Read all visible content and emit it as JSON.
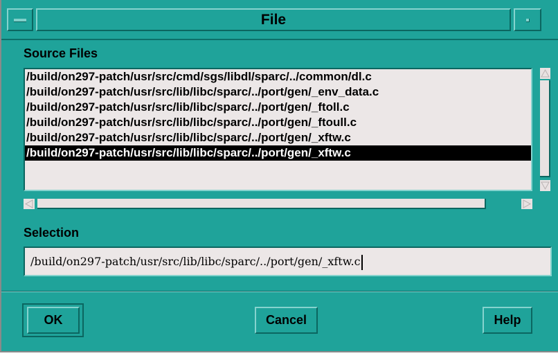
{
  "window": {
    "title": "File"
  },
  "source_files": {
    "label": "Source Files",
    "items": [
      "/build/on297-patch/usr/src/cmd/sgs/libdl/sparc/../common/dl.c",
      "/build/on297-patch/usr/src/lib/libc/sparc/../port/gen/_env_data.c",
      "/build/on297-patch/usr/src/lib/libc/sparc/../port/gen/_ftoll.c",
      "/build/on297-patch/usr/src/lib/libc/sparc/../port/gen/_ftoull.c",
      "/build/on297-patch/usr/src/lib/libc/sparc/../port/gen/_xftw.c",
      "/build/on297-patch/usr/src/lib/libc/sparc/../port/gen/_xftw.c"
    ],
    "selected_index": 5
  },
  "selection": {
    "label": "Selection",
    "value": "/build/on297-patch/usr/src/lib/libc/sparc/../port/gen/_xftw.c"
  },
  "buttons": {
    "ok": "OK",
    "cancel": "Cancel",
    "help": "Help"
  },
  "colors": {
    "window_bg": "#1fa39a",
    "list_bg": "#ece7e7",
    "selected_bg": "#000000",
    "selected_text": "#ffffff"
  },
  "icons": {
    "menu": "window-menu-icon",
    "minimize": "minimize-icon"
  }
}
